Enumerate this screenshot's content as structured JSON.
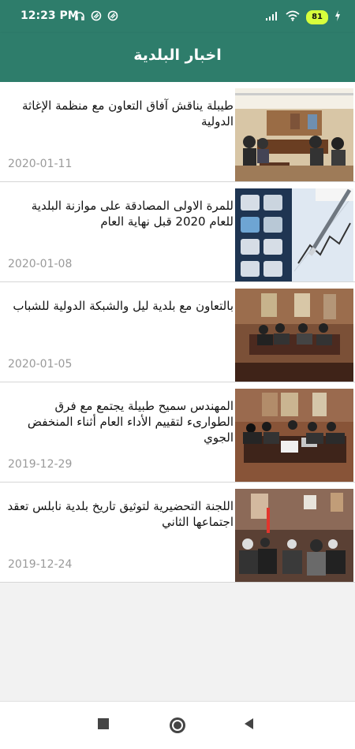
{
  "status": {
    "time": "12:23 PM",
    "battery": "81"
  },
  "app": {
    "title": "اخبار البلدية"
  },
  "news": [
    {
      "title": "طيبلة يناقش آفاق التعاون مع منظمة الإغاثة الدولية",
      "date": "2020-01-11",
      "image": "meeting-room-photo"
    },
    {
      "title": "للمرة الاولى المصادقة على موازنة البلدية للعام 2020 قبل نهاية العام",
      "date": "2020-01-08",
      "image": "calculator-pen-chart-photo"
    },
    {
      "title": "بالتعاون مع بلدية ليل والشبكة الدولية للشباب",
      "date": "2020-01-05",
      "image": "conference-meeting-photo"
    },
    {
      "title": "المهندس سميح طبيلة يجتمع مع فرق الطوارىء لتقييم الأداء العام أثناء المنخفض الجوي",
      "date": "2019-12-29",
      "image": "emergency-team-meeting-photo"
    },
    {
      "title": "اللجنة التحضيرية لتوثيق تاريخ بلدية نابلس تعقد اجتماعها الثاني",
      "date": "2019-12-24",
      "image": "committee-meeting-photo"
    }
  ],
  "navigation": {
    "square": "recent-apps",
    "circle": "home",
    "triangle": "back"
  }
}
